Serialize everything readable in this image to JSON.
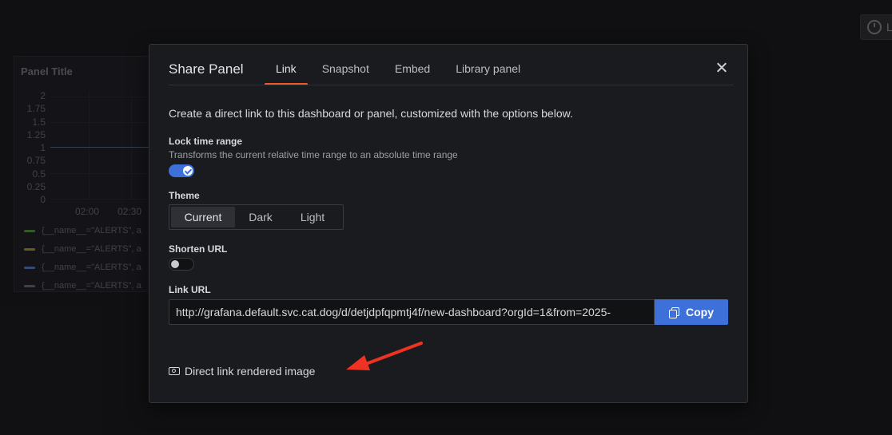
{
  "background": {
    "time_button_label": "L",
    "panel": {
      "title": "Panel Title",
      "y_ticks": [
        "2",
        "1.75",
        "1.5",
        "1.25",
        "1",
        "0.75",
        "0.5",
        "0.25",
        "0"
      ],
      "x_ticks": [
        "02:00",
        "02:30"
      ],
      "legend": [
        {
          "label": "{__name__=\"ALERTS\", a",
          "color": "#5a9a3e"
        },
        {
          "label": "{__name__=\"ALERTS\", a",
          "color": "#b59a28"
        },
        {
          "label": "{__name__=\"ALERTS\", a",
          "color": "#5b7fcc"
        },
        {
          "label": "{__name__=\"ALERTS\", a",
          "color": "#6c6e74"
        }
      ]
    }
  },
  "modal": {
    "title": "Share Panel",
    "tabs": [
      {
        "label": "Link",
        "active": true
      },
      {
        "label": "Snapshot",
        "active": false
      },
      {
        "label": "Embed",
        "active": false
      },
      {
        "label": "Library panel",
        "active": false
      }
    ],
    "description": "Create a direct link to this dashboard or panel, customized with the options below.",
    "lock_time_range": {
      "label": "Lock time range",
      "description": "Transforms the current relative time range to an absolute time range",
      "enabled": true
    },
    "theme": {
      "label": "Theme",
      "options": [
        "Current",
        "Dark",
        "Light"
      ],
      "selected": "Current"
    },
    "shorten_url": {
      "label": "Shorten URL",
      "enabled": false
    },
    "link_url": {
      "label": "Link URL",
      "value": "http://grafana.default.svc.cat.dog/d/detjdpfqpmtj4f/new-dashboard?orgId=1&from=2025-",
      "copy_label": "Copy"
    },
    "direct_link_label": "Direct link rendered image"
  },
  "colors": {
    "accent_tab": "#f05a28",
    "primary_button": "#3d71d9",
    "annotation_arrow": "#ee3322"
  }
}
